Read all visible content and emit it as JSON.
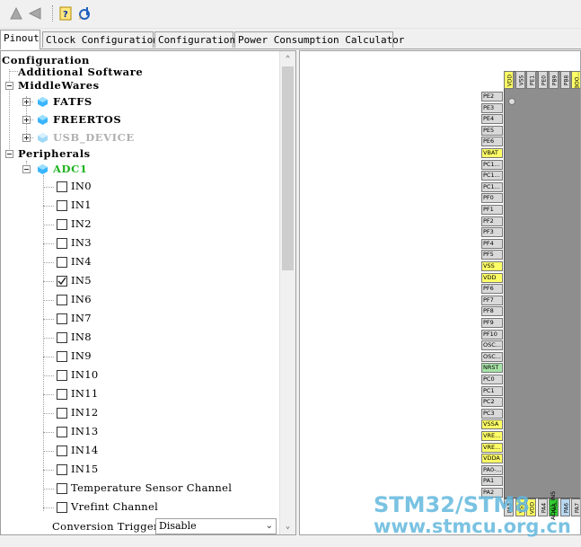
{
  "toolbar": {
    "buttons": [
      {
        "icon": "up-triangle-icon"
      },
      {
        "icon": "left-triangle-icon"
      },
      {
        "icon": "help-icon"
      },
      {
        "icon": "about-icon"
      }
    ]
  },
  "tabs": [
    "Pinout",
    "Clock Configuration",
    "Configuration",
    "Power Consumption Calculator"
  ],
  "tree": {
    "configuration": "Configuration",
    "additional_software": "Additional Software",
    "middlewares": "MiddleWares",
    "fatfs": "FATFS",
    "freertos": "FREERTOS",
    "usb_device": "USB_DEVICE",
    "peripherals": "Peripherals",
    "adc1": "ADC1",
    "channels": [
      {
        "label": "IN0",
        "checked": false
      },
      {
        "label": "IN1",
        "checked": false
      },
      {
        "label": "IN2",
        "checked": false
      },
      {
        "label": "IN3",
        "checked": false
      },
      {
        "label": "IN4",
        "checked": false
      },
      {
        "label": "IN5",
        "checked": true
      },
      {
        "label": "IN6",
        "checked": false
      },
      {
        "label": "IN7",
        "checked": false
      },
      {
        "label": "IN8",
        "checked": false
      },
      {
        "label": "IN9",
        "checked": false
      },
      {
        "label": "IN10",
        "checked": false
      },
      {
        "label": "IN11",
        "checked": false
      },
      {
        "label": "IN12",
        "checked": false
      },
      {
        "label": "IN13",
        "checked": false
      },
      {
        "label": "IN14",
        "checked": false
      },
      {
        "label": "IN15",
        "checked": false
      },
      {
        "label": "Temperature Sensor Channel",
        "checked": false
      },
      {
        "label": "Vrefint Channel",
        "checked": false
      }
    ],
    "conversion_trigger_label": "Conversion Trigger",
    "conversion_trigger_value": "Disable"
  },
  "chip": {
    "left_pins": [
      {
        "label": "PE2",
        "color": "gray"
      },
      {
        "label": "PE3",
        "color": "gray"
      },
      {
        "label": "PE4",
        "color": "gray"
      },
      {
        "label": "PE5",
        "color": "gray"
      },
      {
        "label": "PE6",
        "color": "gray"
      },
      {
        "label": "VBAT",
        "color": "yellow"
      },
      {
        "label": "PC1...",
        "color": "gray"
      },
      {
        "label": "PC1...",
        "color": "gray"
      },
      {
        "label": "PC1...",
        "color": "gray"
      },
      {
        "label": "PF0",
        "color": "gray"
      },
      {
        "label": "PF1",
        "color": "gray"
      },
      {
        "label": "PF2",
        "color": "gray"
      },
      {
        "label": "PF3",
        "color": "gray"
      },
      {
        "label": "PF4",
        "color": "gray"
      },
      {
        "label": "PF5",
        "color": "gray"
      },
      {
        "label": "VSS",
        "color": "yellow"
      },
      {
        "label": "VDD",
        "color": "yellow"
      },
      {
        "label": "PF6",
        "color": "gray"
      },
      {
        "label": "PF7",
        "color": "gray"
      },
      {
        "label": "PF8",
        "color": "gray"
      },
      {
        "label": "PF9",
        "color": "gray"
      },
      {
        "label": "PF10",
        "color": "gray"
      },
      {
        "label": "OSC...",
        "color": "gray"
      },
      {
        "label": "OSC...",
        "color": "gray"
      },
      {
        "label": "NRST",
        "color": "green"
      },
      {
        "label": "PC0",
        "color": "gray"
      },
      {
        "label": "PC1",
        "color": "gray"
      },
      {
        "label": "PC2",
        "color": "gray"
      },
      {
        "label": "PC3",
        "color": "gray"
      },
      {
        "label": "VSSA",
        "color": "yellow"
      },
      {
        "label": "VRE...",
        "color": "yellow"
      },
      {
        "label": "VRE...",
        "color": "yellow"
      },
      {
        "label": "VDDA",
        "color": "yellow"
      },
      {
        "label": "PA0-...",
        "color": "gray"
      },
      {
        "label": "PA1",
        "color": "gray"
      },
      {
        "label": "PA2",
        "color": "gray"
      }
    ],
    "top_pins": [
      {
        "label": "VDD",
        "color": "yellow"
      },
      {
        "label": "VSS",
        "color": "gray"
      },
      {
        "label": "PE1",
        "color": "gray"
      },
      {
        "label": "PE0",
        "color": "gray"
      },
      {
        "label": "PB9",
        "color": "gray"
      },
      {
        "label": "PB8",
        "color": "gray"
      },
      {
        "label": "BOO...",
        "color": "yellow"
      }
    ],
    "bottom_pins": [
      {
        "label": "PA3",
        "color": "gray"
      },
      {
        "label": "VSS",
        "color": "yellow"
      },
      {
        "label": "VDD",
        "color": "yellow"
      },
      {
        "label": "PA4",
        "color": "gray"
      },
      {
        "label": "PA5",
        "color": "green"
      },
      {
        "label": "PA6",
        "color": "blue"
      },
      {
        "label": "PA7",
        "color": "gray"
      }
    ],
    "adc_pin_label": "ADC1_IN5"
  },
  "watermark": {
    "line1": "STM32/STM8",
    "line2": "www.stmcu.org.cn"
  }
}
